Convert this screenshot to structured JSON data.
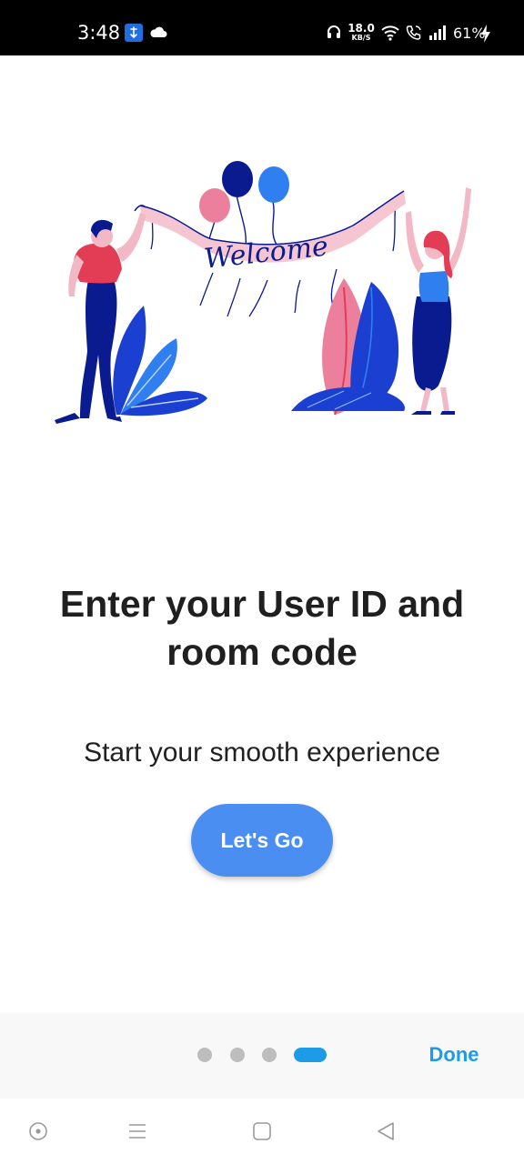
{
  "status_bar": {
    "time": "3:48",
    "network_speed_value": "18.0",
    "network_speed_unit": "KB/S",
    "battery": "61%",
    "icons": [
      "vpn-key-icon",
      "cloud-icon",
      "headset-icon",
      "wifi-icon",
      "wifi-calling-icon",
      "signal-icon",
      "charging-icon"
    ]
  },
  "illustration": {
    "banner_text": "Welcome",
    "colors": {
      "blue": "#1a3fd1",
      "navy": "#0a1a8f",
      "pink": "#f2b8c6",
      "rose": "#ec7f9c",
      "red": "#e23d54",
      "sky": "#2f7ff0"
    }
  },
  "content": {
    "headline": "Enter your User ID and room code",
    "subtitle": "Start your smooth experience",
    "primary_button": "Let's Go"
  },
  "pager": {
    "dots_total": 4,
    "active_index": 3,
    "done_label": "Done"
  },
  "nav_bar": {
    "icons": [
      "assistant-icon",
      "menu-icon",
      "home-icon",
      "back-icon"
    ]
  },
  "colors": {
    "accent": "#4a8ef2",
    "pager_active": "#1e9be6",
    "pager_inactive": "#bdbdbd",
    "headline_text": "#1f1f1f"
  }
}
